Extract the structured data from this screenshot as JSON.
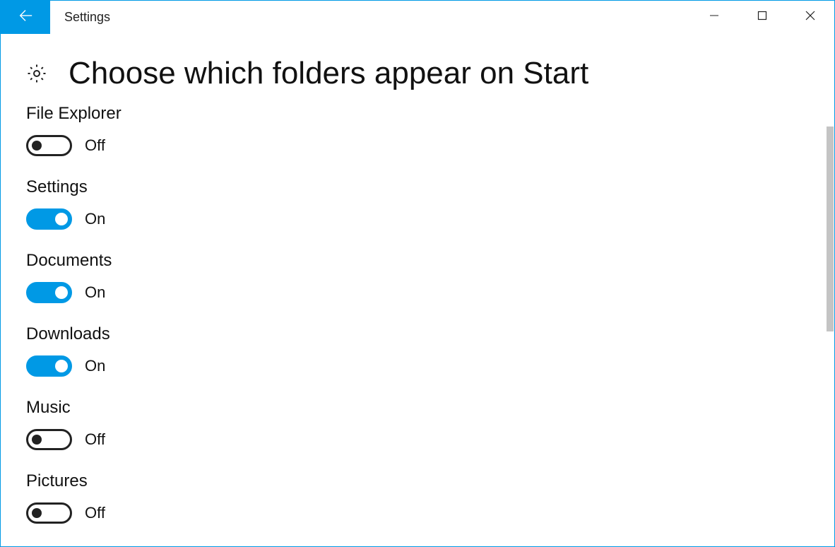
{
  "window": {
    "title": "Settings",
    "accent_color": "#0099e5"
  },
  "page": {
    "title": "Choose which folders appear on Start"
  },
  "labels": {
    "on": "On",
    "off": "Off"
  },
  "settings": [
    {
      "name": "File Explorer",
      "state": "off"
    },
    {
      "name": "Settings",
      "state": "on"
    },
    {
      "name": "Documents",
      "state": "on"
    },
    {
      "name": "Downloads",
      "state": "on"
    },
    {
      "name": "Music",
      "state": "off"
    },
    {
      "name": "Pictures",
      "state": "off"
    }
  ]
}
